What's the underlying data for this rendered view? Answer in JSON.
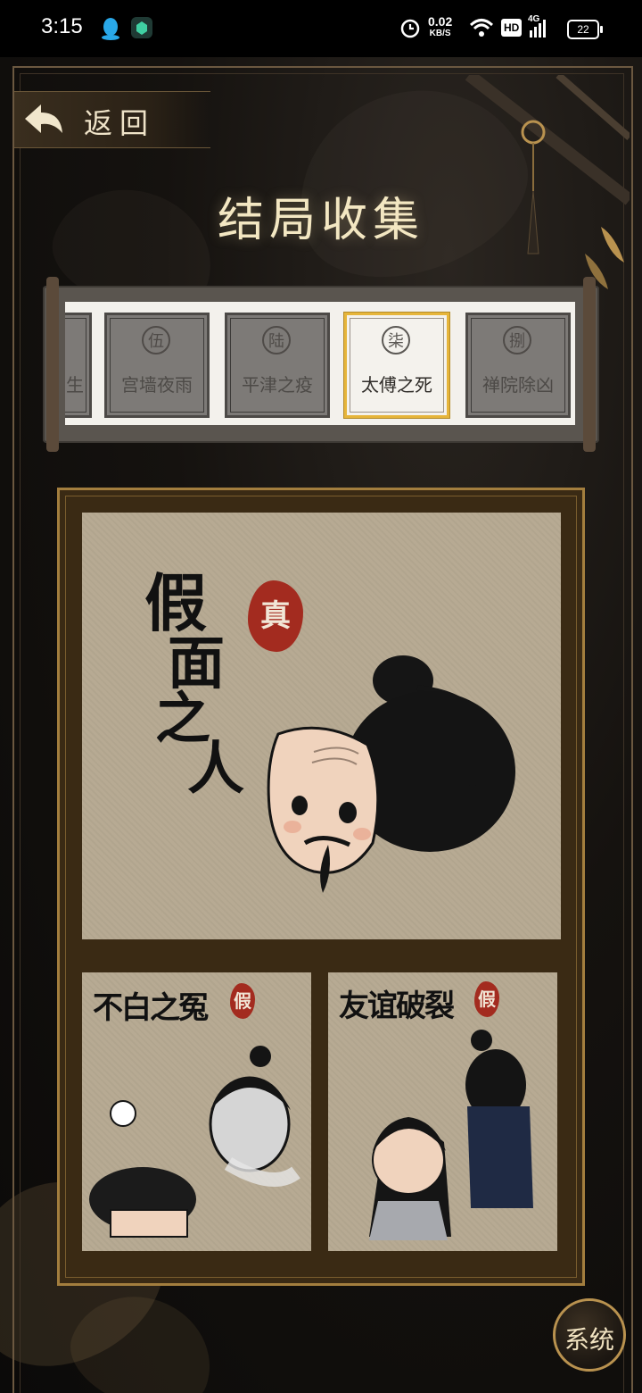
{
  "status_bar": {
    "time": "3:15",
    "net_speed": "0.02",
    "net_unit": "KB/S",
    "hd": "HD",
    "signal": "4G",
    "battery": "22"
  },
  "header": {
    "back_label": "返回",
    "title": "结局收集"
  },
  "chapters": [
    {
      "num": "",
      "name": "生",
      "state": "partial"
    },
    {
      "num": "伍",
      "name": "宫墙夜雨",
      "state": "locked"
    },
    {
      "num": "陆",
      "name": "平津之疫",
      "state": "locked"
    },
    {
      "num": "柒",
      "name": "太傅之死",
      "state": "selected"
    },
    {
      "num": "捌",
      "name": "禅院除凶",
      "state": "locked"
    }
  ],
  "endings": {
    "main": {
      "title_lines": [
        "假",
        "面",
        "之",
        "人"
      ],
      "seal": "真"
    },
    "left": {
      "title": "不白之冤",
      "seal": "假"
    },
    "right": {
      "title": "友谊破裂",
      "seal": "假"
    }
  },
  "system_button": "系统",
  "colors": {
    "accent_gold": "#e6b53a",
    "seal_red": "#a32b1f",
    "paper": "#b7aa93",
    "frame": "#a37e3e"
  }
}
